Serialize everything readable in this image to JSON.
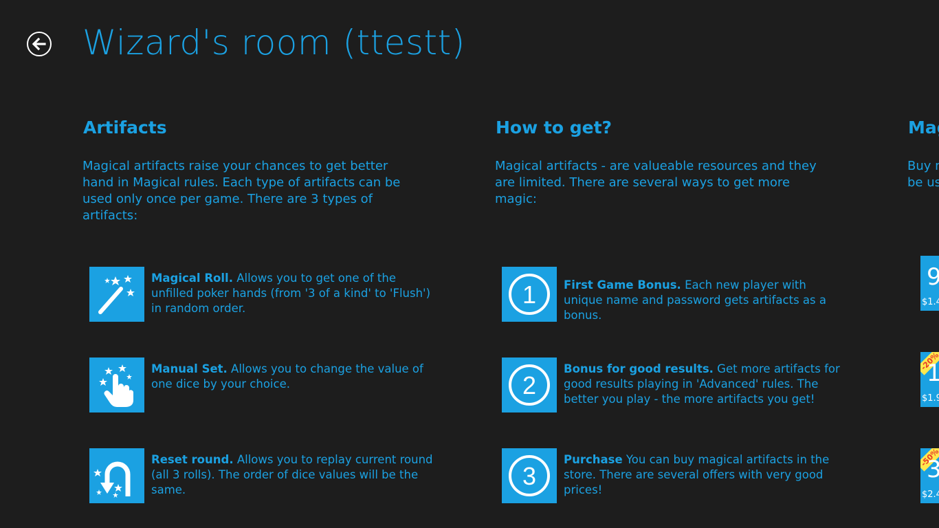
{
  "header": {
    "title": "Wizard's room (ttestt)"
  },
  "artifacts": {
    "title": "Artifacts",
    "intro": "Magical artifacts raise your chances to get better hand in Magical rules. Each type of artifacts can be used only once per game. There are 3 types of artifacts:",
    "items": [
      {
        "icon": "magic-wand-icon",
        "name": "Magical Roll.",
        "desc": " Allows you to get one of the unfilled poker hands (from '3 of a kind' to 'Flush') in random order."
      },
      {
        "icon": "pointing-hand-icon",
        "name": "Manual Set.",
        "desc": " Allows you to change the value of one dice by your choice."
      },
      {
        "icon": "u-turn-icon",
        "name": "Reset round.",
        "desc": "  Allows you to replay current round (all 3 rolls). The order of  dice values will be the same."
      }
    ]
  },
  "how_to_get": {
    "title": "How to get?",
    "intro": "Magical artifacts - are valueable resources and they are limited. There are several ways to get more magic:",
    "items": [
      {
        "number": "1",
        "name": "First Game Bonus.",
        "desc": "  Each new player with unique name and password gets artifacts as a bonus."
      },
      {
        "number": "2",
        "name": "Bonus for good results.",
        "desc": "  Get more artifacts for good results playing in 'Advanced' rules. The better you play - the more artifacts you get!"
      },
      {
        "number": "3",
        "name": "Purchase",
        "desc": " You can buy magical artifacts in the store. There are several offers with very good prices!"
      }
    ]
  },
  "store": {
    "title": "Mag",
    "intro_line1": "Buy m",
    "intro_line2": "be us",
    "offers": [
      {
        "big": "9",
        "price": "$1.4",
        "badge": ""
      },
      {
        "big": "1",
        "price": "$1.9",
        "badge": "-20%"
      },
      {
        "big": "3",
        "price": "$2.4",
        "badge": "-50%"
      }
    ]
  },
  "colors": {
    "background": "#1d1d1d",
    "accent": "#1ba1e2",
    "badge": "#ffe84d"
  }
}
